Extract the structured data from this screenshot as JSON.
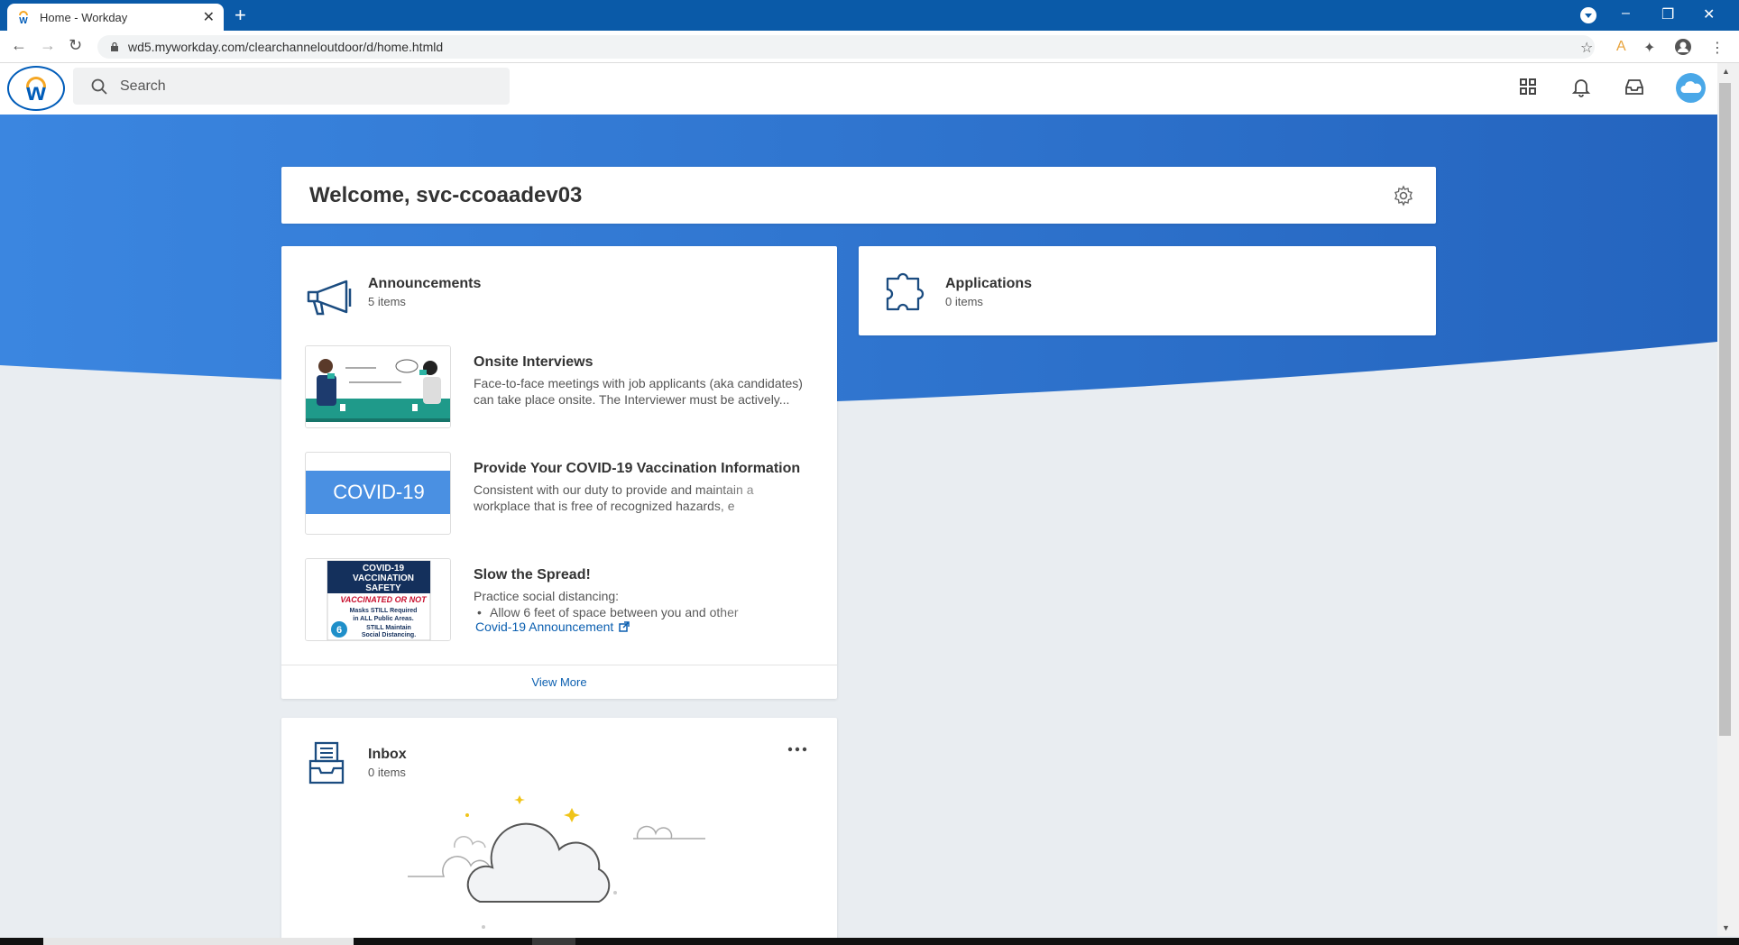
{
  "browser": {
    "tab_title": "Home - Workday",
    "new_tab": "+",
    "url": "wd5.myworkday.com/clearchanneloutdoor/d/home.htmld",
    "min": "–",
    "restore": "❐",
    "close": "✕"
  },
  "header": {
    "search_placeholder": "Search"
  },
  "welcome": {
    "title": "Welcome, svc-ccoaadev03"
  },
  "announcements": {
    "title": "Announcements",
    "count": "5 items",
    "items": [
      {
        "title": "Onsite Interviews",
        "desc": "Face-to-face meetings with job applicants (aka candidates) can take place onsite. The Interviewer must be actively..."
      },
      {
        "title": "Provide Your COVID-19 Vaccination Information",
        "desc": "Consistent with our duty to provide and maintain a workplace that is free of recognized hazards, e",
        "banner": "COVID-19"
      },
      {
        "title": "Slow the Spread!",
        "desc": "Practice social distancing:",
        "bullet": "Allow 6 feet of space between you and other",
        "link": "Covid-19 Announcement",
        "poster": {
          "l1": "COVID-19",
          "l2": "VACCINATION",
          "l3": "SAFETY",
          "l4": "VACCINATED OR NOT",
          "l5": "Masks STILL Required",
          "l6": "in ALL Public Areas.",
          "l7": "STILL Maintain",
          "l8": "Social Distancing.",
          "num": "6"
        }
      }
    ],
    "view_more": "View More"
  },
  "applications": {
    "title": "Applications",
    "count": "0 items"
  },
  "inbox": {
    "title": "Inbox",
    "count": "0 items"
  },
  "colors": {
    "brand_blue": "#005cb9",
    "hero_blue": "#2f7fd8",
    "link": "#0b5fb0"
  }
}
